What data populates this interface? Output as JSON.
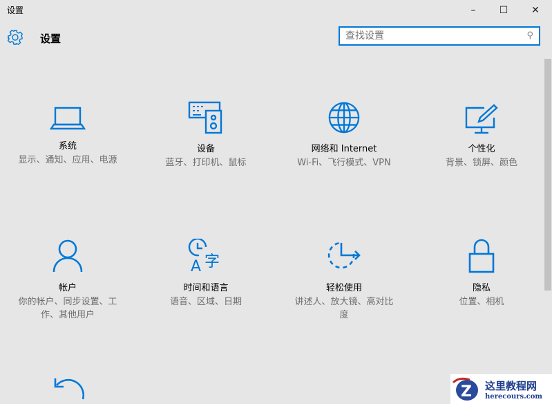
{
  "window": {
    "title": "设置",
    "minimize": "–",
    "maximize": "☐",
    "close": "✕"
  },
  "header": {
    "title": "设置",
    "icon": "gear-icon"
  },
  "search": {
    "placeholder": "查找设置",
    "icon": "search-icon"
  },
  "tiles": [
    {
      "title": "系统",
      "subtitle": "显示、通知、应用、电源",
      "icon": "laptop-icon"
    },
    {
      "title": "设备",
      "subtitle": "蓝牙、打印机、鼠标",
      "icon": "devices-icon"
    },
    {
      "title": "网络和 Internet",
      "subtitle": "Wi-Fi、飞行模式、VPN",
      "icon": "globe-icon"
    },
    {
      "title": "个性化",
      "subtitle": "背景、锁屏、颜色",
      "icon": "personalization-icon"
    },
    {
      "title": "帐户",
      "subtitle": "你的帐户、同步设置、工作、其他用户",
      "icon": "person-icon"
    },
    {
      "title": "时间和语言",
      "subtitle": "语音、区域、日期",
      "icon": "time-language-icon"
    },
    {
      "title": "轻松使用",
      "subtitle": "讲述人、放大镜、高对比度",
      "icon": "ease-of-access-icon"
    },
    {
      "title": "隐私",
      "subtitle": "位置、相机",
      "icon": "lock-icon"
    },
    {
      "title": "",
      "subtitle": "",
      "icon": "update-icon"
    }
  ],
  "watermark": {
    "name": "这里教程网",
    "url": "herecours.com"
  },
  "colors": {
    "accent": "#0078d7",
    "background": "#e6e6e6"
  }
}
